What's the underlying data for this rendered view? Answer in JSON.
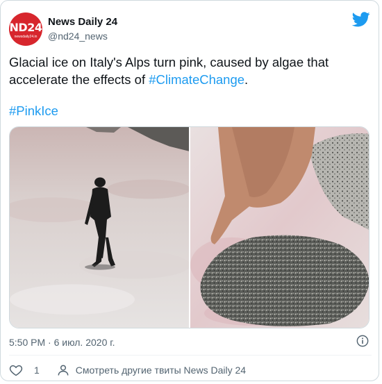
{
  "author": {
    "name": "News Daily 24",
    "handle": "@nd24_news",
    "avatar_text": "ND24",
    "avatar_tagline": "newsdaily24.in"
  },
  "tweet": {
    "text_part1": "Glacial ice on Italy's Alps turn pink, caused by algae that accelerate the effects of ",
    "hashtag_inline": "#ClimateChange",
    "text_part2": ".",
    "hashtag_line": "#PinkIce"
  },
  "timestamp": "5:50 PM · 6 июл. 2020 г.",
  "actions": {
    "like_count": "1",
    "more_tweets_label": "Смотреть другие твиты News Daily 24"
  },
  "colors": {
    "link": "#1d9bf0",
    "secondary_text": "#536471",
    "avatar_bg": "#d7262d"
  },
  "icons": [
    "twitter-bird-icon",
    "info-icon",
    "heart-icon",
    "person-icon"
  ]
}
